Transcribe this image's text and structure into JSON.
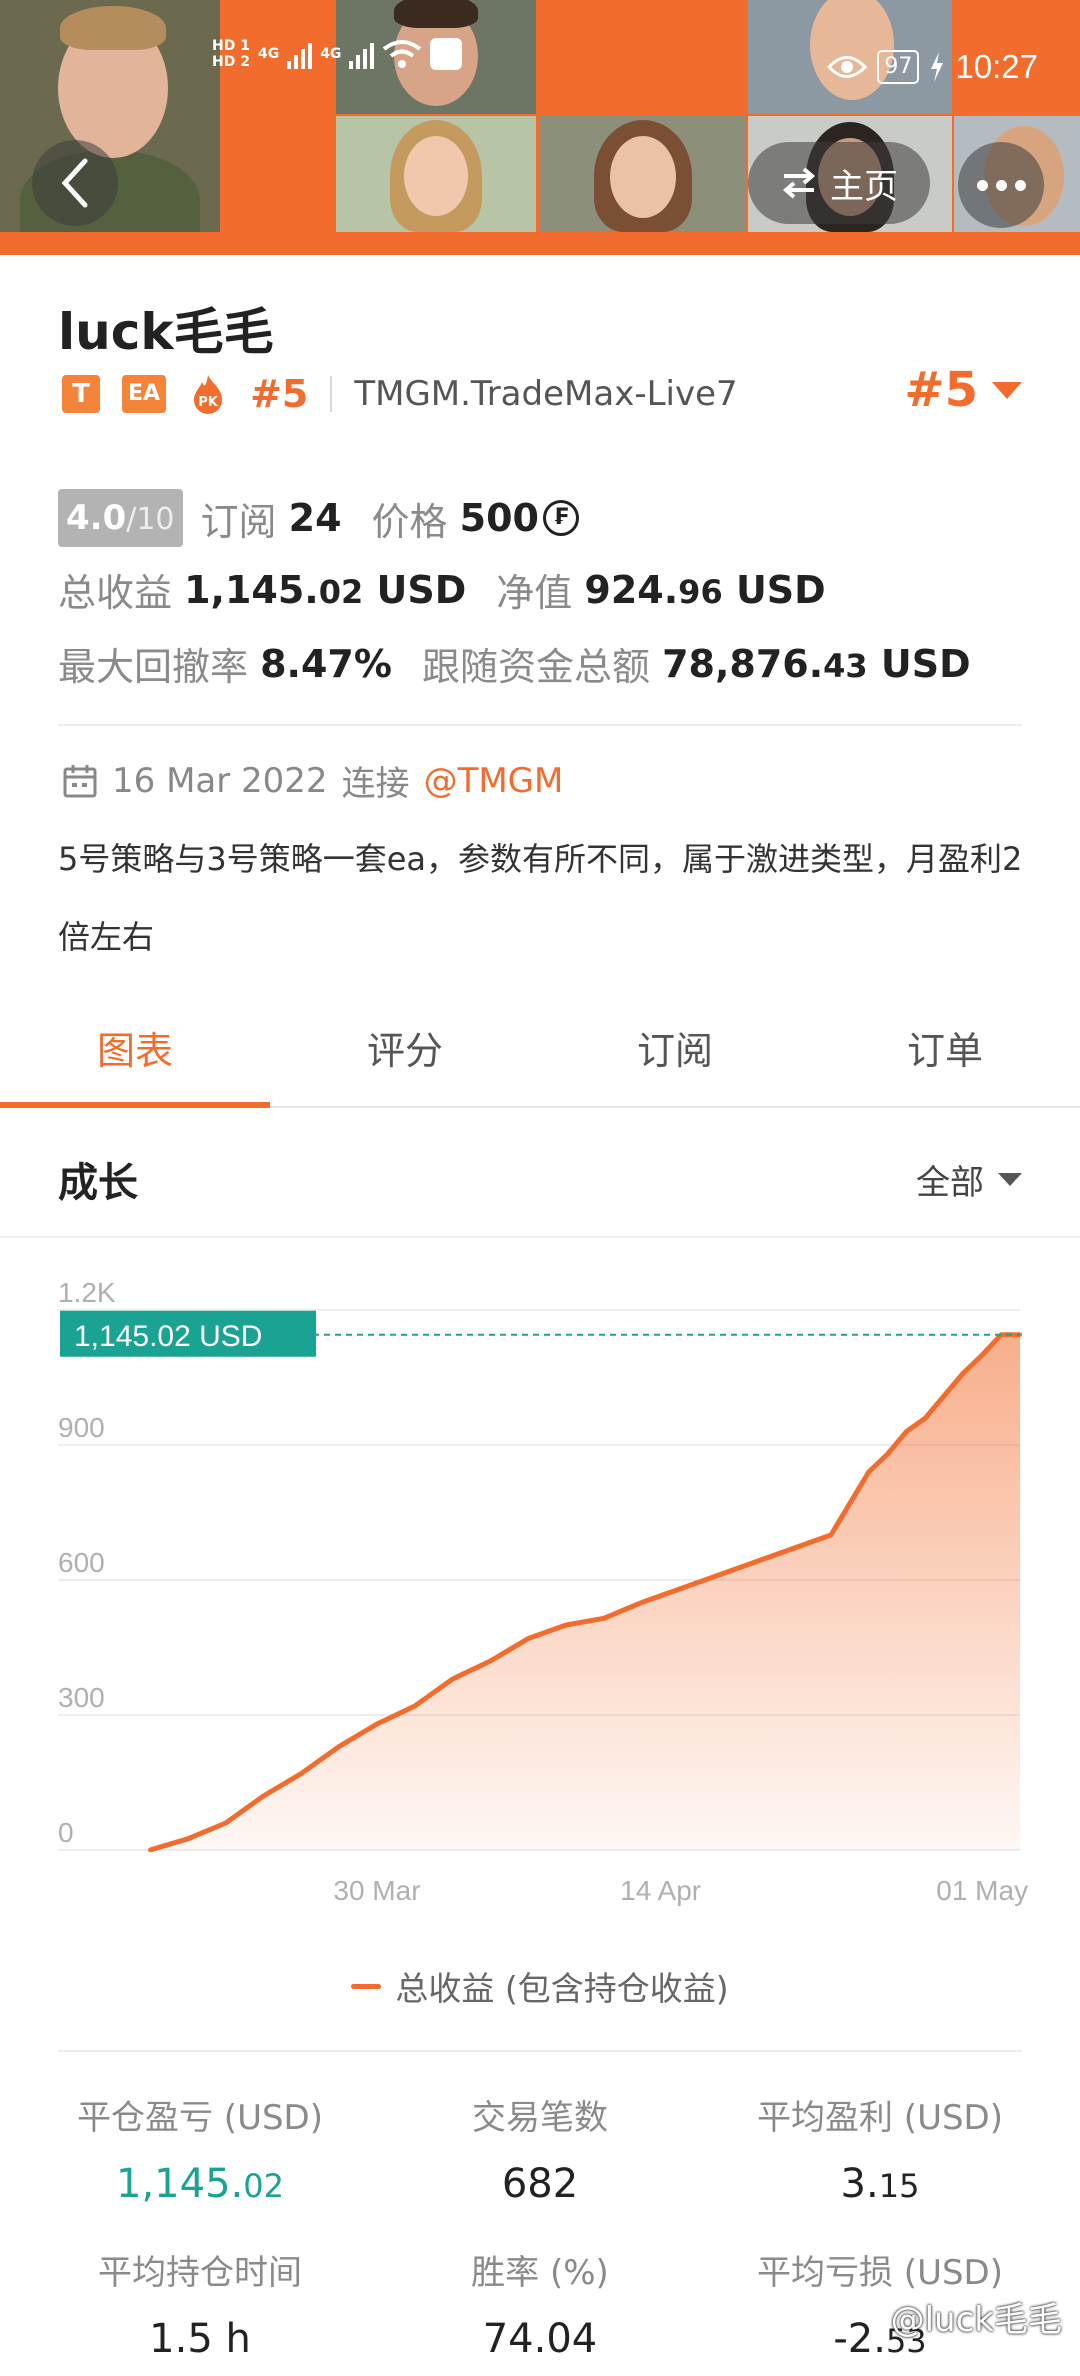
{
  "status_bar": {
    "sim1": "HD 1",
    "sim2": "HD 2",
    "network1": "4G",
    "network2": "4G",
    "battery": "97",
    "time": "10:27"
  },
  "header": {
    "home_label": "主页",
    "back_icon": "chevron-left-icon",
    "switch_icon": "swap-icon",
    "more_icon": "more-dots-icon"
  },
  "profile": {
    "name": "luck毛毛",
    "badges": [
      "T",
      "EA",
      "PK"
    ],
    "rank_small": "#5",
    "server": "TMGM.TradeMax-Live7",
    "rank_big": "#5"
  },
  "stats": {
    "score": "4.0",
    "score_max": "/10",
    "subscribe_label": "订阅",
    "subscribe_value": "24",
    "price_label": "价格",
    "price_value": "500",
    "coin_symbol": "₣",
    "total_profit_label": "总收益",
    "total_profit_int": "1,145.",
    "total_profit_dec": "02",
    "total_profit_unit": "USD",
    "net_value_label": "净值",
    "net_value_int": "924.",
    "net_value_dec": "96",
    "net_value_unit": "USD",
    "drawdown_label": "最大回撤率",
    "drawdown_value": "8.47%",
    "follow_label": "跟随资金总额",
    "follow_int": "78,876.",
    "follow_dec": "43",
    "follow_unit": "USD"
  },
  "connection": {
    "date": "16 Mar 2022",
    "connect_label": "连接",
    "broker": "@TMGM"
  },
  "description": "5号策略与3号策略一套ea，参数有所不同，属于激进类型，月盈利2倍左右",
  "tabs": [
    "图表",
    "评分",
    "订阅",
    "订单"
  ],
  "growth": {
    "title": "成长",
    "filter": "全部"
  },
  "chart_data": {
    "type": "area",
    "current_label": "1,145.02 USD",
    "y_ticks": [
      "0",
      "300",
      "600",
      "900",
      "1.2K"
    ],
    "x_ticks": [
      "30 Mar",
      "14 Apr",
      "01 May"
    ],
    "ylim": [
      0,
      1200
    ],
    "legend": "总收益 (包含持仓收益)",
    "color": "#f26d2d",
    "x": [
      "2022-03-18",
      "2022-03-20",
      "2022-03-22",
      "2022-03-24",
      "2022-03-26",
      "2022-03-28",
      "2022-03-30",
      "2022-04-01",
      "2022-04-03",
      "2022-04-05",
      "2022-04-07",
      "2022-04-09",
      "2022-04-11",
      "2022-04-13",
      "2022-04-15",
      "2022-04-17",
      "2022-04-19",
      "2022-04-21",
      "2022-04-23",
      "2022-04-25",
      "2022-04-26",
      "2022-04-27",
      "2022-04-28",
      "2022-04-29",
      "2022-04-30",
      "2022-05-01",
      "2022-05-02",
      "2022-05-03"
    ],
    "values": [
      0,
      25,
      60,
      120,
      170,
      230,
      280,
      320,
      380,
      420,
      470,
      500,
      515,
      550,
      580,
      610,
      640,
      670,
      700,
      840,
      880,
      930,
      960,
      1010,
      1060,
      1100,
      1145,
      1145
    ]
  },
  "metrics": [
    {
      "label": "平仓盈亏 (USD)",
      "value_int": "1,145.",
      "value_dec": "02",
      "green": true
    },
    {
      "label": "交易笔数",
      "value_int": "682",
      "value_dec": "",
      "green": false
    },
    {
      "label": "平均盈利 (USD)",
      "value_int": "3.",
      "value_dec": "15",
      "green": false
    },
    {
      "label": "平均持仓时间",
      "value_int": "1.5 h",
      "value_dec": "",
      "green": false
    },
    {
      "label": "胜率 (%)",
      "value_int": "74.04",
      "value_dec": "",
      "green": false
    },
    {
      "label": "平均亏损 (USD)",
      "value_int": "-2.",
      "value_dec": "53",
      "green": false
    }
  ],
  "watermark": "@luck毛毛"
}
